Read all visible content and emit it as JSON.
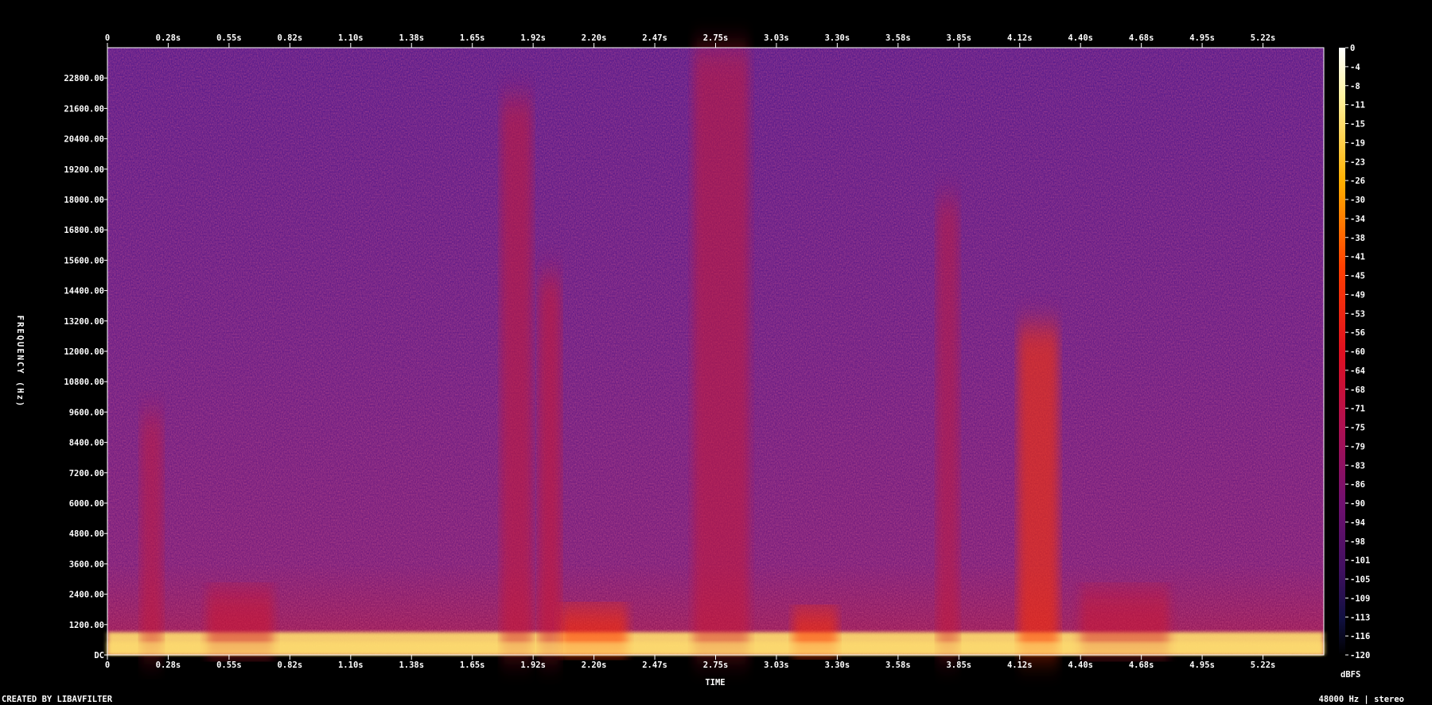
{
  "chart_data": {
    "type": "heatmap",
    "subtype": "spectrogram",
    "xlabel": "TIME",
    "ylabel": "FREQUENCY (Hz)",
    "x_ticks": [
      "0",
      "0.28s",
      "0.55s",
      "0.82s",
      "1.10s",
      "1.38s",
      "1.65s",
      "1.92s",
      "2.20s",
      "2.47s",
      "2.75s",
      "3.03s",
      "3.30s",
      "3.58s",
      "3.85s",
      "4.12s",
      "4.40s",
      "4.68s",
      "4.95s",
      "5.22s"
    ],
    "x_unit": "s",
    "x_range": [
      0,
      5.5
    ],
    "y_ticks": [
      "DC",
      "1200.00",
      "2400.00",
      "3600.00",
      "4800.00",
      "6000.00",
      "7200.00",
      "8400.00",
      "9600.00",
      "10800.00",
      "12000.00",
      "13200.00",
      "14400.00",
      "15600.00",
      "16800.00",
      "18000.00",
      "19200.00",
      "20400.00",
      "21600.00",
      "22800.00"
    ],
    "y_unit": "Hz",
    "y_range": [
      0,
      24000
    ],
    "colorbar": {
      "label": "dBFS",
      "ticks": [
        "0",
        "-4",
        "-8",
        "-11",
        "-15",
        "-19",
        "-23",
        "-26",
        "-30",
        "-34",
        "-38",
        "-41",
        "-45",
        "-49",
        "-53",
        "-56",
        "-60",
        "-64",
        "-68",
        "-71",
        "-75",
        "-79",
        "-83",
        "-86",
        "-90",
        "-94",
        "-98",
        "-101",
        "-105",
        "-109",
        "-113",
        "-116",
        "-120"
      ],
      "range": [
        -120,
        0
      ]
    },
    "colors": {
      "background": "#000000",
      "floor": "#5a1f8a",
      "mid": "#d0182e",
      "hot": "#ff3000",
      "peak": "#ffe070"
    },
    "energy_bursts": [
      {
        "t_start": 0.0,
        "t_end": 5.5,
        "f_max": 900,
        "db": -10
      },
      {
        "t_start": 0.15,
        "t_end": 0.25,
        "f_max": 9500,
        "db": -55
      },
      {
        "t_start": 0.45,
        "t_end": 0.75,
        "f_max": 2600,
        "db": -40
      },
      {
        "t_start": 1.78,
        "t_end": 1.92,
        "f_max": 22000,
        "db": -48
      },
      {
        "t_start": 1.95,
        "t_end": 2.05,
        "f_max": 15000,
        "db": -42
      },
      {
        "t_start": 2.05,
        "t_end": 2.35,
        "f_max": 1900,
        "db": -30
      },
      {
        "t_start": 2.65,
        "t_end": 2.9,
        "f_max": 24000,
        "db": -50
      },
      {
        "t_start": 3.1,
        "t_end": 3.3,
        "f_max": 1800,
        "db": -32
      },
      {
        "t_start": 3.75,
        "t_end": 3.85,
        "f_max": 18000,
        "db": -56
      },
      {
        "t_start": 4.12,
        "t_end": 4.3,
        "f_max": 13000,
        "db": -36
      },
      {
        "t_start": 4.4,
        "t_end": 4.8,
        "f_max": 2600,
        "db": -45
      }
    ]
  },
  "footer": {
    "left": "CREATED BY LIBAVFILTER",
    "right": "48000 Hz | stereo"
  }
}
